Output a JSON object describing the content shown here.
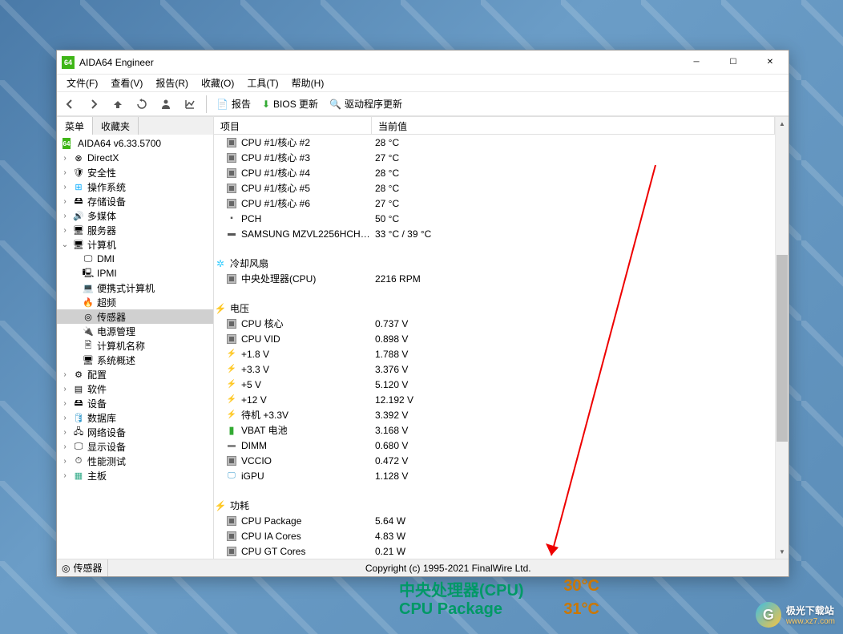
{
  "window": {
    "title": "AIDA64 Engineer",
    "app_badge": "64"
  },
  "menu": {
    "file": "文件(F)",
    "view": "查看(V)",
    "report": "报告(R)",
    "favorites": "收藏(O)",
    "tools": "工具(T)",
    "help": "帮助(H)"
  },
  "toolbar": {
    "report": "报告",
    "bios_update": "BIOS 更新",
    "driver_update": "驱动程序更新"
  },
  "sidebar": {
    "tab_menu": "菜单",
    "tab_fav": "收藏夹",
    "root": "AIDA64 v6.33.5700",
    "items": [
      "DirectX",
      "安全性",
      "操作系统",
      "存储设备",
      "多媒体",
      "服务器"
    ],
    "computer": {
      "label": "计算机",
      "children": [
        "DMI",
        "IPMI",
        "便携式计算机",
        "超频",
        "传感器",
        "电源管理",
        "计算机名称",
        "系统概述"
      ]
    },
    "items2": [
      "配置",
      "软件",
      "设备",
      "数据库",
      "网络设备",
      "显示设备",
      "性能测试",
      "主板"
    ]
  },
  "columns": {
    "item": "项目",
    "value": "当前值"
  },
  "sections": {
    "cooling": "冷却风扇",
    "voltage": "电压",
    "power": "功耗"
  },
  "temps": [
    {
      "name": "CPU #1/核心 #2",
      "val": "28 °C"
    },
    {
      "name": "CPU #1/核心 #3",
      "val": "27 °C"
    },
    {
      "name": "CPU #1/核心 #4",
      "val": "28 °C"
    },
    {
      "name": "CPU #1/核心 #5",
      "val": "28 °C"
    },
    {
      "name": "CPU #1/核心 #6",
      "val": "27 °C"
    },
    {
      "name": "PCH",
      "val": "50 °C"
    },
    {
      "name": "SAMSUNG MZVL2256HCHQ...",
      "val": "33 °C / 39 °C"
    }
  ],
  "fans": [
    {
      "name": "中央处理器(CPU)",
      "val": "2216 RPM"
    }
  ],
  "voltages": [
    {
      "name": "CPU 核心",
      "val": "0.737 V",
      "icon": "chip"
    },
    {
      "name": "CPU VID",
      "val": "0.898 V",
      "icon": "chip"
    },
    {
      "name": "+1.8 V",
      "val": "1.788 V",
      "icon": "bolt"
    },
    {
      "name": "+3.3 V",
      "val": "3.376 V",
      "icon": "bolt"
    },
    {
      "name": "+5 V",
      "val": "5.120 V",
      "icon": "bolt"
    },
    {
      "name": "+12 V",
      "val": "12.192 V",
      "icon": "bolt"
    },
    {
      "name": "待机 +3.3V",
      "val": "3.392 V",
      "icon": "bolt"
    },
    {
      "name": "VBAT 电池",
      "val": "3.168 V",
      "icon": "batt"
    },
    {
      "name": "DIMM",
      "val": "0.680 V",
      "icon": "dimm"
    },
    {
      "name": "VCCIO",
      "val": "0.472 V",
      "icon": "chip"
    },
    {
      "name": "iGPU",
      "val": "1.128 V",
      "icon": "gpu"
    }
  ],
  "powers": [
    {
      "name": "CPU Package",
      "val": "5.64 W"
    },
    {
      "name": "CPU IA Cores",
      "val": "4.83 W"
    },
    {
      "name": "CPU GT Cores",
      "val": "0.21 W"
    }
  ],
  "status": {
    "label": "传感器",
    "copyright": "Copyright (c) 1995-2021 FinalWire Ltd."
  },
  "hud": {
    "cpu_label": "中央处理器(CPU)",
    "cpu_val": "30°C",
    "pkg_label": "CPU Package",
    "pkg_val": "31°C"
  },
  "watermark": {
    "name": "极光下载站",
    "url": "www.xz7.com"
  }
}
